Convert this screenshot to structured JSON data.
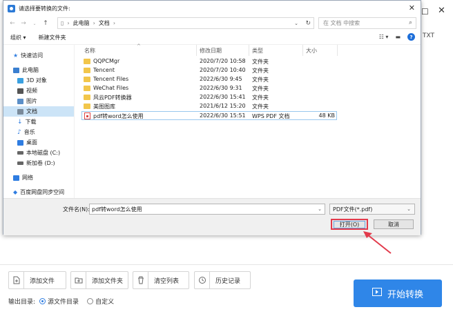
{
  "background_app": {
    "right_partial_text": "TXT",
    "buttons": [
      {
        "label": "添加文件",
        "icon": "add-file-icon"
      },
      {
        "label": "添加文件夹",
        "icon": "add-folder-icon"
      },
      {
        "label": "清空列表",
        "icon": "trash-icon"
      },
      {
        "label": "历史记录",
        "icon": "history-icon"
      }
    ],
    "output_label": "输出目录:",
    "output_options": [
      {
        "label": "源文件目录",
        "selected": true
      },
      {
        "label": "自定义",
        "selected": false
      }
    ],
    "start_button": "开始转换",
    "accent_color": "#2f86e8"
  },
  "dialog": {
    "title": "请选择要转换的文件:",
    "address": {
      "path": [
        "此电脑",
        "文档"
      ],
      "search_placeholder": "在 文档 中搜索"
    },
    "toolbar": {
      "organize": "组织 ▾",
      "new_folder": "新建文件夹"
    },
    "sidebar": [
      {
        "label": "快速访问",
        "level": 0,
        "icon": "star-icon",
        "color": "#2f7de1"
      },
      {
        "label": "此电脑",
        "level": 0,
        "icon": "computer-icon",
        "color": "#3a7fd0"
      },
      {
        "label": "3D 对象",
        "level": 1,
        "icon": "cube-icon",
        "color": "#3aa0e0"
      },
      {
        "label": "视频",
        "level": 1,
        "icon": "video-icon",
        "color": "#555555"
      },
      {
        "label": "图片",
        "level": 1,
        "icon": "picture-icon",
        "color": "#5b8fc8"
      },
      {
        "label": "文档",
        "level": 1,
        "icon": "document-icon",
        "color": "#7a8a9a",
        "selected": true
      },
      {
        "label": "下载",
        "level": 1,
        "icon": "download-icon",
        "color": "#2f7de1"
      },
      {
        "label": "音乐",
        "level": 1,
        "icon": "music-icon",
        "color": "#2f7de1"
      },
      {
        "label": "桌面",
        "level": 1,
        "icon": "desktop-icon",
        "color": "#2f7de1"
      },
      {
        "label": "本地磁盘 (C:)",
        "level": 1,
        "icon": "disk-icon",
        "color": "#666666"
      },
      {
        "label": "新加卷 (D:)",
        "level": 1,
        "icon": "disk-icon",
        "color": "#666666"
      },
      {
        "label": "网络",
        "level": 0,
        "icon": "network-icon",
        "color": "#2f7de1"
      },
      {
        "label": "百度网盘同步空间",
        "level": 0,
        "icon": "cloud-icon",
        "color": "#2f7de1"
      }
    ],
    "columns": [
      "名称",
      "修改日期",
      "类型",
      "大小"
    ],
    "files": [
      {
        "name": "QQPCMgr",
        "date": "2020/7/20 10:58",
        "type": "文件夹",
        "size": "",
        "kind": "folder"
      },
      {
        "name": "Tencent",
        "date": "2020/7/20 10:40",
        "type": "文件夹",
        "size": "",
        "kind": "folder"
      },
      {
        "name": "Tencent Files",
        "date": "2022/6/30 9:45",
        "type": "文件夹",
        "size": "",
        "kind": "folder"
      },
      {
        "name": "WeChat Files",
        "date": "2022/6/30 9:31",
        "type": "文件夹",
        "size": "",
        "kind": "folder"
      },
      {
        "name": "风云PDF转换器",
        "date": "2022/6/30 15:41",
        "type": "文件夹",
        "size": "",
        "kind": "folder"
      },
      {
        "name": "美图图库",
        "date": "2021/6/12 15:20",
        "type": "文件夹",
        "size": "",
        "kind": "folder"
      },
      {
        "name": "pdf转word怎么使用",
        "date": "2022/6/30 15:51",
        "type": "WPS PDF 文档",
        "size": "48 KB",
        "kind": "pdf",
        "selected": true
      }
    ],
    "filename_label": "文件名(N):",
    "filename_value": "pdf转word怎么使用",
    "filetype_value": "PDF文件(*.pdf)",
    "open_button": "打开(O)",
    "cancel_button": "取消",
    "highlight_color": "#e23a4b"
  }
}
